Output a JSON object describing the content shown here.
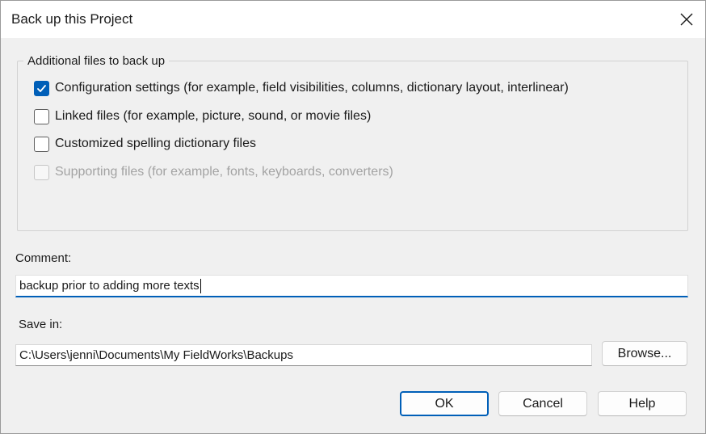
{
  "window": {
    "title": "Back up this Project",
    "close_icon": "close-icon"
  },
  "additional_files": {
    "legend": "Additional files to back up",
    "options": [
      {
        "label": "Configuration settings (for example, field visibilities, columns, dictionary layout, interlinear)",
        "checked": true,
        "enabled": true
      },
      {
        "label": "Linked files (for example, picture, sound, or movie files)",
        "checked": false,
        "enabled": true
      },
      {
        "label": "Customized spelling dictionary files",
        "checked": false,
        "enabled": true
      },
      {
        "label": "Supporting files (for example, fonts, keyboards, converters)",
        "checked": false,
        "enabled": false
      }
    ]
  },
  "comment": {
    "label": "Comment:",
    "value": "backup prior to adding more texts"
  },
  "save_in": {
    "label": "Save in:",
    "value": "C:\\Users\\jenni\\Documents\\My FieldWorks\\Backups",
    "browse_label": "Browse..."
  },
  "buttons": {
    "ok": "OK",
    "cancel": "Cancel",
    "help": "Help"
  },
  "colors": {
    "accent": "#005fb8",
    "disabled_text": "#a3a3a3"
  }
}
